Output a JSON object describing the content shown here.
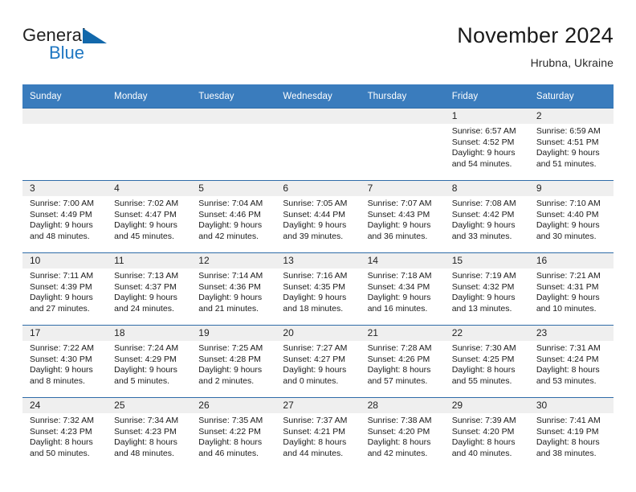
{
  "brand": {
    "word1": "General",
    "word2": "Blue",
    "accent_color": "#1f77c2",
    "triangle_color": "#1268ab"
  },
  "header": {
    "title": "November 2024",
    "location": "Hrubna, Ukraine"
  },
  "theme": {
    "header_row_bg": "#3a7cbd",
    "day_band_bg": "#efefef",
    "row_divider": "#2f6ca8"
  },
  "weekdays": [
    "Sunday",
    "Monday",
    "Tuesday",
    "Wednesday",
    "Thursday",
    "Friday",
    "Saturday"
  ],
  "weeks": [
    [
      {
        "day": "",
        "info": ""
      },
      {
        "day": "",
        "info": ""
      },
      {
        "day": "",
        "info": ""
      },
      {
        "day": "",
        "info": ""
      },
      {
        "day": "",
        "info": ""
      },
      {
        "day": "1",
        "info": "Sunrise: 6:57 AM\nSunset: 4:52 PM\nDaylight: 9 hours\nand 54 minutes."
      },
      {
        "day": "2",
        "info": "Sunrise: 6:59 AM\nSunset: 4:51 PM\nDaylight: 9 hours\nand 51 minutes."
      }
    ],
    [
      {
        "day": "3",
        "info": "Sunrise: 7:00 AM\nSunset: 4:49 PM\nDaylight: 9 hours\nand 48 minutes."
      },
      {
        "day": "4",
        "info": "Sunrise: 7:02 AM\nSunset: 4:47 PM\nDaylight: 9 hours\nand 45 minutes."
      },
      {
        "day": "5",
        "info": "Sunrise: 7:04 AM\nSunset: 4:46 PM\nDaylight: 9 hours\nand 42 minutes."
      },
      {
        "day": "6",
        "info": "Sunrise: 7:05 AM\nSunset: 4:44 PM\nDaylight: 9 hours\nand 39 minutes."
      },
      {
        "day": "7",
        "info": "Sunrise: 7:07 AM\nSunset: 4:43 PM\nDaylight: 9 hours\nand 36 minutes."
      },
      {
        "day": "8",
        "info": "Sunrise: 7:08 AM\nSunset: 4:42 PM\nDaylight: 9 hours\nand 33 minutes."
      },
      {
        "day": "9",
        "info": "Sunrise: 7:10 AM\nSunset: 4:40 PM\nDaylight: 9 hours\nand 30 minutes."
      }
    ],
    [
      {
        "day": "10",
        "info": "Sunrise: 7:11 AM\nSunset: 4:39 PM\nDaylight: 9 hours\nand 27 minutes."
      },
      {
        "day": "11",
        "info": "Sunrise: 7:13 AM\nSunset: 4:37 PM\nDaylight: 9 hours\nand 24 minutes."
      },
      {
        "day": "12",
        "info": "Sunrise: 7:14 AM\nSunset: 4:36 PM\nDaylight: 9 hours\nand 21 minutes."
      },
      {
        "day": "13",
        "info": "Sunrise: 7:16 AM\nSunset: 4:35 PM\nDaylight: 9 hours\nand 18 minutes."
      },
      {
        "day": "14",
        "info": "Sunrise: 7:18 AM\nSunset: 4:34 PM\nDaylight: 9 hours\nand 16 minutes."
      },
      {
        "day": "15",
        "info": "Sunrise: 7:19 AM\nSunset: 4:32 PM\nDaylight: 9 hours\nand 13 minutes."
      },
      {
        "day": "16",
        "info": "Sunrise: 7:21 AM\nSunset: 4:31 PM\nDaylight: 9 hours\nand 10 minutes."
      }
    ],
    [
      {
        "day": "17",
        "info": "Sunrise: 7:22 AM\nSunset: 4:30 PM\nDaylight: 9 hours\nand 8 minutes."
      },
      {
        "day": "18",
        "info": "Sunrise: 7:24 AM\nSunset: 4:29 PM\nDaylight: 9 hours\nand 5 minutes."
      },
      {
        "day": "19",
        "info": "Sunrise: 7:25 AM\nSunset: 4:28 PM\nDaylight: 9 hours\nand 2 minutes."
      },
      {
        "day": "20",
        "info": "Sunrise: 7:27 AM\nSunset: 4:27 PM\nDaylight: 9 hours\nand 0 minutes."
      },
      {
        "day": "21",
        "info": "Sunrise: 7:28 AM\nSunset: 4:26 PM\nDaylight: 8 hours\nand 57 minutes."
      },
      {
        "day": "22",
        "info": "Sunrise: 7:30 AM\nSunset: 4:25 PM\nDaylight: 8 hours\nand 55 minutes."
      },
      {
        "day": "23",
        "info": "Sunrise: 7:31 AM\nSunset: 4:24 PM\nDaylight: 8 hours\nand 53 minutes."
      }
    ],
    [
      {
        "day": "24",
        "info": "Sunrise: 7:32 AM\nSunset: 4:23 PM\nDaylight: 8 hours\nand 50 minutes."
      },
      {
        "day": "25",
        "info": "Sunrise: 7:34 AM\nSunset: 4:23 PM\nDaylight: 8 hours\nand 48 minutes."
      },
      {
        "day": "26",
        "info": "Sunrise: 7:35 AM\nSunset: 4:22 PM\nDaylight: 8 hours\nand 46 minutes."
      },
      {
        "day": "27",
        "info": "Sunrise: 7:37 AM\nSunset: 4:21 PM\nDaylight: 8 hours\nand 44 minutes."
      },
      {
        "day": "28",
        "info": "Sunrise: 7:38 AM\nSunset: 4:20 PM\nDaylight: 8 hours\nand 42 minutes."
      },
      {
        "day": "29",
        "info": "Sunrise: 7:39 AM\nSunset: 4:20 PM\nDaylight: 8 hours\nand 40 minutes."
      },
      {
        "day": "30",
        "info": "Sunrise: 7:41 AM\nSunset: 4:19 PM\nDaylight: 8 hours\nand 38 minutes."
      }
    ]
  ]
}
